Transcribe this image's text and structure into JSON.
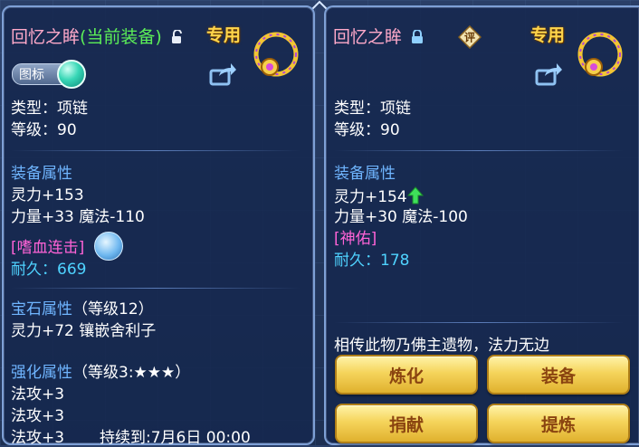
{
  "left": {
    "title_name": "回忆之眸",
    "title_tag": "(当前装备)",
    "exclusive": "专用",
    "icon_toggle": "图标",
    "type": "类型：项链",
    "level": "等级：90",
    "equip_attr_header": "装备属性",
    "spirit": "灵力+153",
    "power_magic": "力量+33 魔法-110",
    "special_skill": "[嗜血连击]",
    "durability_label": "耐久：",
    "durability_value": "669",
    "gem_header": "宝石属性",
    "gem_level": "（等级12）",
    "gem_line": "灵力+72 镶嵌舍利子",
    "enhance_header": "强化属性",
    "enhance_level": "（等级3:★★★）",
    "enhance_lines": [
      "法攻+3",
      "法攻+3",
      "法攻+3"
    ],
    "duration": "持续到:7月6日 00:00"
  },
  "right": {
    "title_name": "回忆之眸",
    "rating_badge": "评",
    "exclusive": "专用",
    "type": "类型：项链",
    "level": "等级：90",
    "equip_attr_header": "装备属性",
    "spirit": "灵力+154",
    "power_magic": "力量+30 魔法-100",
    "special_skill": "[神佑]",
    "durability_label": "耐久：",
    "durability_value": "178",
    "description": "相传此物乃佛主遗物，法力无边"
  },
  "buttons": {
    "refine": "炼化",
    "equip": "装备",
    "donate": "捐献",
    "extract": "提炼"
  },
  "icons": [
    "lock-open-icon",
    "lock-closed-icon",
    "necklace-icon",
    "share-icon",
    "rating-icon",
    "skill-icon",
    "up-arrow-icon"
  ],
  "colors": {
    "title_name": "#ffa9c9",
    "current_tag": "#5cef57",
    "exclusive": "#ffd54b",
    "section": "#6fb5ff",
    "durability": "#4fd3ff",
    "special_skill": "#ff63d6",
    "button": "#f5d45b"
  }
}
